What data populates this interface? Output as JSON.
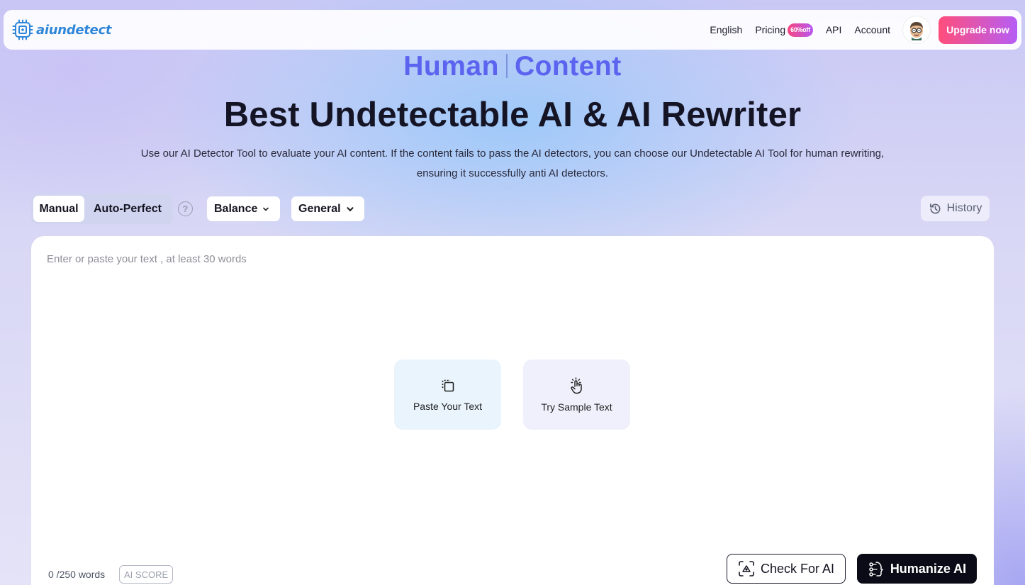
{
  "header": {
    "logo_text": "aiundetect",
    "nav": {
      "language": "English",
      "pricing": "Pricing",
      "pricing_badge": "60%off",
      "api": "API",
      "account": "Account"
    },
    "upgrade_label": "Upgrade now"
  },
  "hero": {
    "animated_word_1": "Human",
    "animated_word_2": "Content",
    "title": "Best Undetectable AI & AI Rewriter",
    "description": "Use our AI Detector Tool to evaluate your AI content. If the content fails to pass the AI detectors, you can choose our Undetectable AI Tool for human rewriting, ensuring it successfully anti AI detectors."
  },
  "controls": {
    "mode_manual": "Manual",
    "mode_auto": "Auto-Perfect",
    "help_symbol": "?",
    "strength_selected": "Balance",
    "purpose_selected": "General",
    "history_label": "History"
  },
  "editor": {
    "placeholder": "Enter or paste your text , at least 30 words",
    "paste_label": "Paste Your Text",
    "sample_label": "Try Sample Text",
    "word_count": "0 /250 words",
    "ai_score_label": "AI SCORE",
    "check_label": "Check For AI",
    "humanize_label": "Humanize AI"
  },
  "icons": {
    "logo": "chip-logo-icon",
    "avatar": "user-avatar",
    "help": "help-icon",
    "chevron": "chevron-down-icon",
    "history": "history-icon",
    "paste": "paste-icon",
    "sample": "tap-hand-icon",
    "check": "ai-scan-icon",
    "humanize": "humanize-icon"
  },
  "colors": {
    "brand": "#2f86d8",
    "hero_accent": "#5b63ef",
    "upgrade_gradient_start": "#ff4e7b",
    "upgrade_gradient_end": "#b65df5",
    "humanize_button": "#0b0b17"
  }
}
